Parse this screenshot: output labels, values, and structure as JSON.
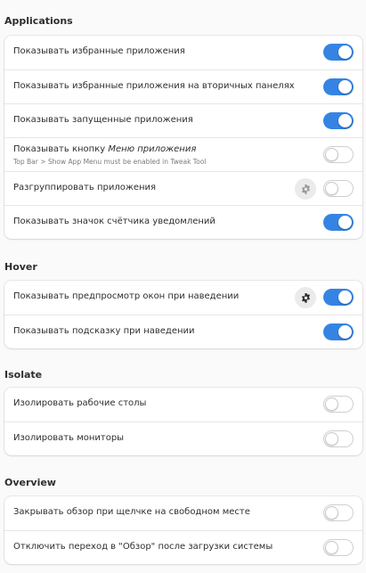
{
  "colors": {
    "accent": "#3584e4",
    "background": "#fafafa",
    "card": "#ffffff"
  },
  "sections": {
    "applications": {
      "title": "Applications",
      "rows": [
        {
          "label": "Показывать избранные приложения",
          "toggle": true
        },
        {
          "label": "Показывать избранные приложения на вторичных панелях",
          "toggle": true
        },
        {
          "label": "Показывать запущенные приложения",
          "toggle": true
        },
        {
          "label_prefix": "Показывать кнопку ",
          "label_italic": "Меню приложения",
          "subtitle": "Top Bar > Show App Menu must be enabled in Tweak Tool",
          "toggle": false
        },
        {
          "label": "Разгруппировать приложения",
          "toggle": false,
          "settings_icon": "gear-icon",
          "settings_enabled": false
        },
        {
          "label": "Показывать значок счётчика уведомлений",
          "toggle": true
        }
      ]
    },
    "hover": {
      "title": "Hover",
      "rows": [
        {
          "label": "Показывать предпросмотр окон при наведении",
          "toggle": true,
          "settings_icon": "gear-icon",
          "settings_enabled": true
        },
        {
          "label": "Показывать подсказку при наведении",
          "toggle": true
        }
      ]
    },
    "isolate": {
      "title": "Isolate",
      "rows": [
        {
          "label": "Изолировать рабочие столы",
          "toggle": false
        },
        {
          "label": "Изолировать мониторы",
          "toggle": false
        }
      ]
    },
    "overview": {
      "title": "Overview",
      "rows": [
        {
          "label": "Закрывать обзор при щелчке на свободном месте",
          "toggle": false
        },
        {
          "label": "Отключить переход в \"Обзор\" после загрузки системы",
          "toggle": false
        }
      ]
    }
  }
}
